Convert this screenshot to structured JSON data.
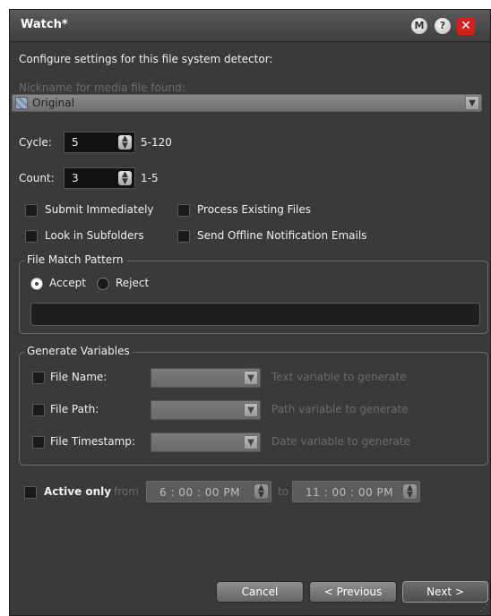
{
  "window": {
    "title": "Watch*"
  },
  "titlebar": {
    "m_label": "M",
    "help_label": "?",
    "close_label": "✕"
  },
  "form": {
    "intro": "Configure settings for this file system detector:",
    "nickname_label": "Nickname for media file found:",
    "nickname_value": "Original",
    "cycle_label": "Cycle:",
    "cycle_value": "5",
    "cycle_range": "5-120",
    "count_label": "Count:",
    "count_value": "3",
    "count_range": "1-5",
    "checkboxes": {
      "submit_immediately": "Submit Immediately",
      "process_existing": "Process Existing Files",
      "look_in_subfolders": "Look in Subfolders",
      "send_offline": "Send Offline Notification Emails"
    }
  },
  "file_match": {
    "legend": "File Match Pattern",
    "accept_label": "Accept",
    "reject_label": "Reject",
    "selected": "Accept",
    "pattern_value": ""
  },
  "generate_variables": {
    "legend": "Generate Variables",
    "rows": [
      {
        "label": "File Name:",
        "placeholder": "Text variable to generate"
      },
      {
        "label": "File Path:",
        "placeholder": "Path variable to generate"
      },
      {
        "label": "File Timestamp:",
        "placeholder": "Date variable to generate"
      }
    ]
  },
  "active": {
    "label": "Active only",
    "from_label": "from",
    "from_value": "6 : 00 : 00  PM",
    "to_label": "to",
    "to_value": "11 : 00 : 00  PM"
  },
  "buttons": {
    "cancel": "Cancel",
    "previous": "< Previous",
    "next": "Next >"
  },
  "colors": {
    "background": "#3a3a3a",
    "close_button": "#d41f1f",
    "input": "#111111"
  }
}
